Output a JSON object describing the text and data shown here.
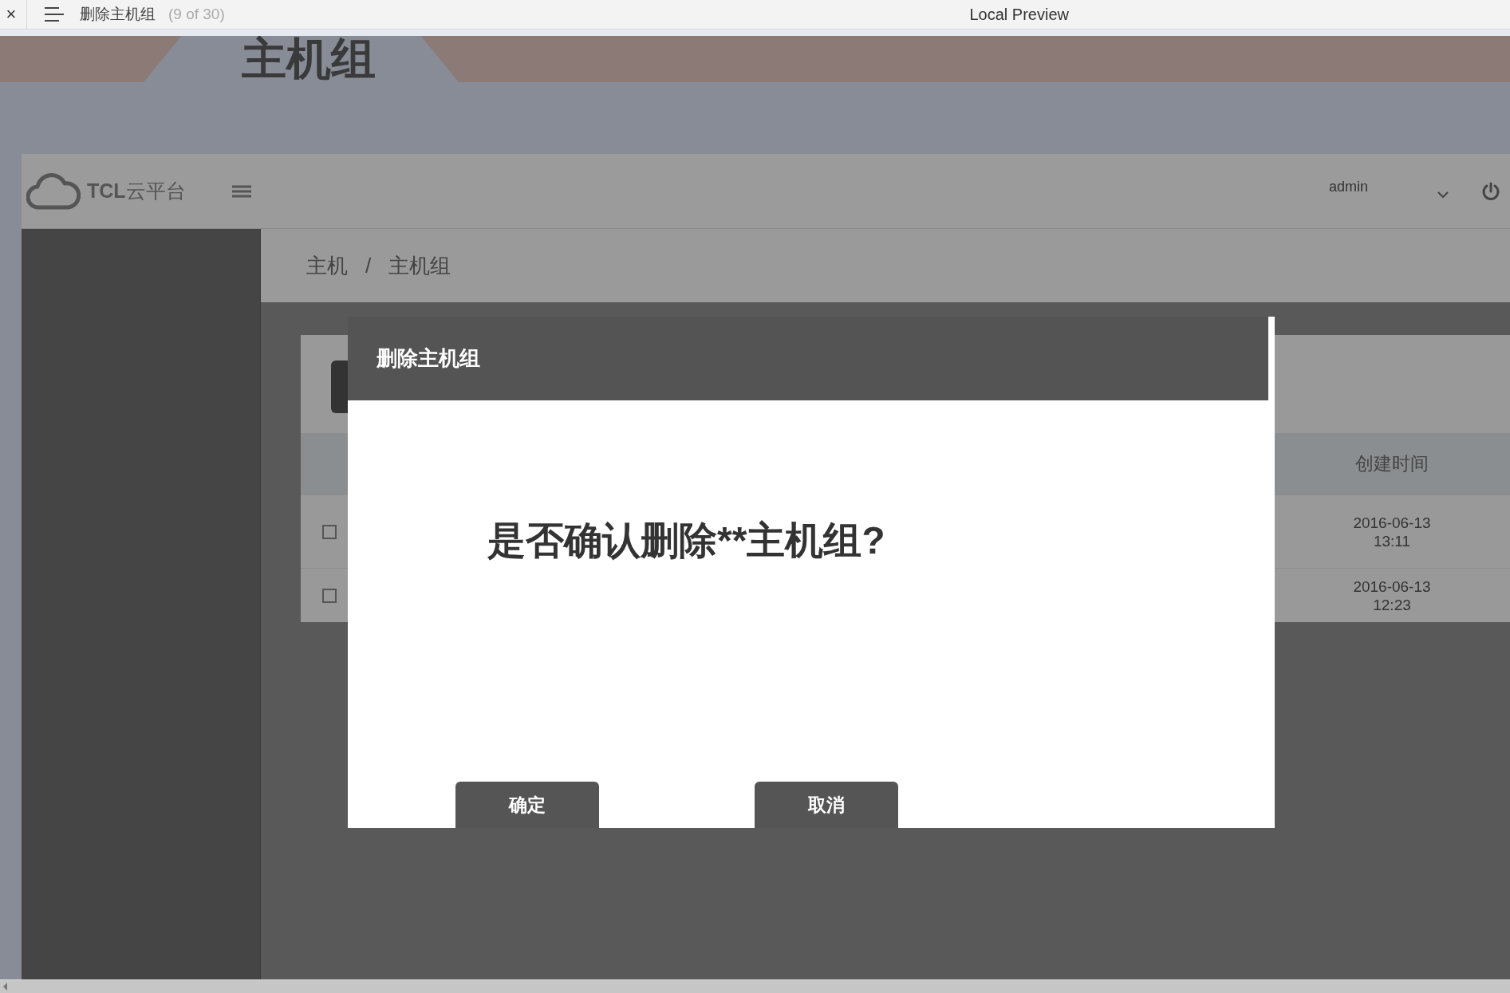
{
  "preview_bar": {
    "close": "×",
    "page_title": "删除主机组",
    "page_count": "(9 of 30)",
    "title": "Local Preview"
  },
  "page_tab": {
    "label": "主机组"
  },
  "header": {
    "brand": "TCL",
    "brand_suffix": "云平台",
    "user": "admin"
  },
  "breadcrumb": {
    "items": [
      "主机",
      "主机组"
    ],
    "separator": "/"
  },
  "table": {
    "columns": [
      {
        "label": "创建时间"
      }
    ],
    "rows": [
      {
        "checked": false,
        "created": "2016-06-13 13:11"
      },
      {
        "checked": false,
        "created": "2016-06-13 12:23"
      }
    ]
  },
  "dialog": {
    "title": "删除主机组",
    "message": "是否确认删除**主机组?",
    "buttons": [
      "确定",
      "取消"
    ]
  }
}
